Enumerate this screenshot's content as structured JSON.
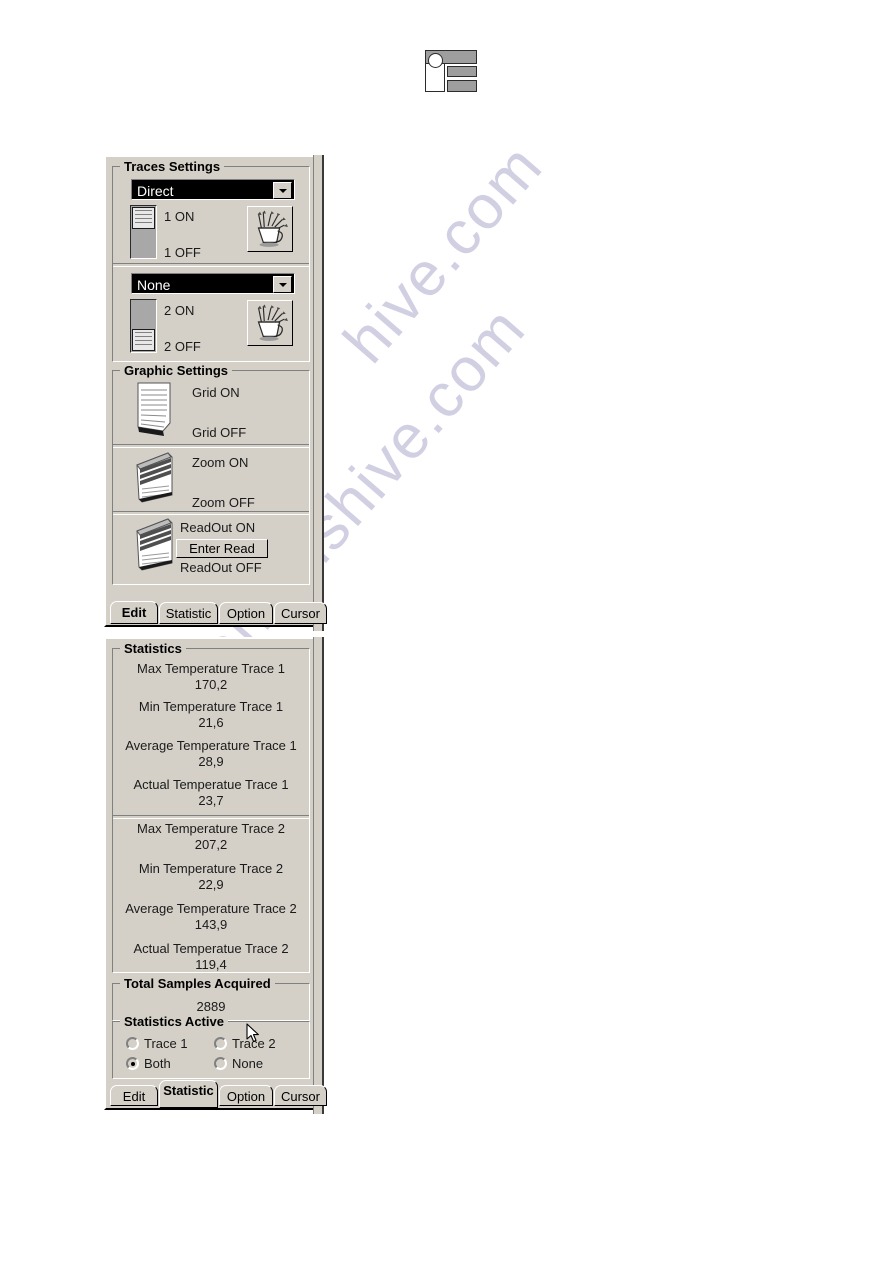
{
  "document": {
    "watermark": [
      "hive.com",
      "manualshive.com"
    ]
  },
  "logo": {
    "name": "company-logo"
  },
  "edit_panel": {
    "traces_settings": {
      "legend": "Traces Settings",
      "trace1": {
        "combo_value": "Direct",
        "slider_on_label": "1 ON",
        "slider_off_label": "1 OFF",
        "slider_position": "on",
        "color_button_icon": "brush-cup-icon"
      },
      "trace2": {
        "combo_value": "None",
        "slider_on_label": "2 ON",
        "slider_off_label": "2 OFF",
        "slider_position": "off",
        "color_button_icon": "brush-cup-icon"
      }
    },
    "graphic_settings": {
      "legend": "Graphic  Settings",
      "grid": {
        "on_label": "Grid ON",
        "off_label": "Grid OFF",
        "lever_icon": "page-lever-icon",
        "state": "off"
      },
      "zoom": {
        "on_label": "Zoom ON",
        "off_label": "Zoom OFF",
        "lever_icon": "page-lever-icon",
        "state": "on"
      },
      "readout": {
        "on_label": "ReadOut ON",
        "off_label": "ReadOut OFF",
        "button_label": "Enter Read",
        "lever_icon": "page-lever-icon",
        "state": "on"
      }
    },
    "tabs": [
      {
        "label": "Edit",
        "selected": true
      },
      {
        "label": "Statistic",
        "selected": false
      },
      {
        "label": "Option",
        "selected": false
      },
      {
        "label": "Cursor",
        "selected": false
      }
    ]
  },
  "statistic_panel": {
    "statistics": {
      "legend": "Statistics",
      "trace1": [
        {
          "label": "Max Temperature Trace 1",
          "value": "170,2"
        },
        {
          "label": "Min Temperature Trace 1",
          "value": "21,6"
        },
        {
          "label": "Average Temperature Trace 1",
          "value": "28,9"
        },
        {
          "label": "Actual Temperatue Trace 1",
          "value": "23,7"
        }
      ],
      "trace2": [
        {
          "label": "Max Temperature Trace 2",
          "value": "207,2"
        },
        {
          "label": "Min Temperature Trace 2",
          "value": "22,9"
        },
        {
          "label": "Average Temperature Trace 2",
          "value": "143,9"
        },
        {
          "label": "Actual Temperatue Trace 2",
          "value": "119,4"
        }
      ]
    },
    "total_samples": {
      "legend": "Total Samples Acquired",
      "value": "2889"
    },
    "statistics_active": {
      "legend": "Statistics Active",
      "options": [
        {
          "label": "Trace 1",
          "selected": false
        },
        {
          "label": "Trace 2",
          "selected": false
        },
        {
          "label": "Both",
          "selected": true
        },
        {
          "label": "None",
          "selected": false
        }
      ]
    },
    "tabs": [
      {
        "label": "Edit",
        "selected": false
      },
      {
        "label": "Statistic",
        "selected": true
      },
      {
        "label": "Option",
        "selected": false
      },
      {
        "label": "Cursor",
        "selected": false
      }
    ]
  }
}
